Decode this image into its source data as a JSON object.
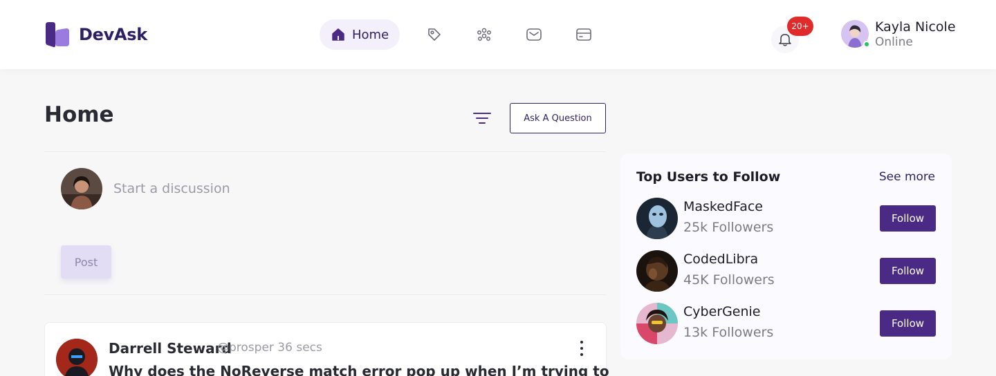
{
  "brand": {
    "name": "DevAsk",
    "primary_color": "#4b2a86",
    "accent_color": "#8b6ad8"
  },
  "nav": {
    "home_label": "Home",
    "items": [
      {
        "icon": "tag-icon"
      },
      {
        "icon": "community-icon"
      },
      {
        "icon": "mail-icon"
      },
      {
        "icon": "card-icon"
      }
    ]
  },
  "notifications": {
    "badge": "20+"
  },
  "user": {
    "name": "Kayla Nicole",
    "status": "Online"
  },
  "page": {
    "title": "Home",
    "ask_button": "Ask A Question"
  },
  "composer": {
    "placeholder": "Start a discussion",
    "post_button": "Post"
  },
  "feed": {
    "items": [
      {
        "author": "Darrell Steward",
        "meta": "@prosper 36 secs",
        "question": "Why does the NoReverse match error pop up when I’m trying to"
      }
    ]
  },
  "sidebar": {
    "title": "Top Users to Follow",
    "see_more": "See more",
    "users": [
      {
        "name": "MaskedFace",
        "followers": "25k Followers",
        "button": "Follow"
      },
      {
        "name": "CodedLibra",
        "followers": "45K Followers",
        "button": "Follow"
      },
      {
        "name": "CyberGenie",
        "followers": "13k Followers",
        "button": "Follow"
      }
    ]
  }
}
